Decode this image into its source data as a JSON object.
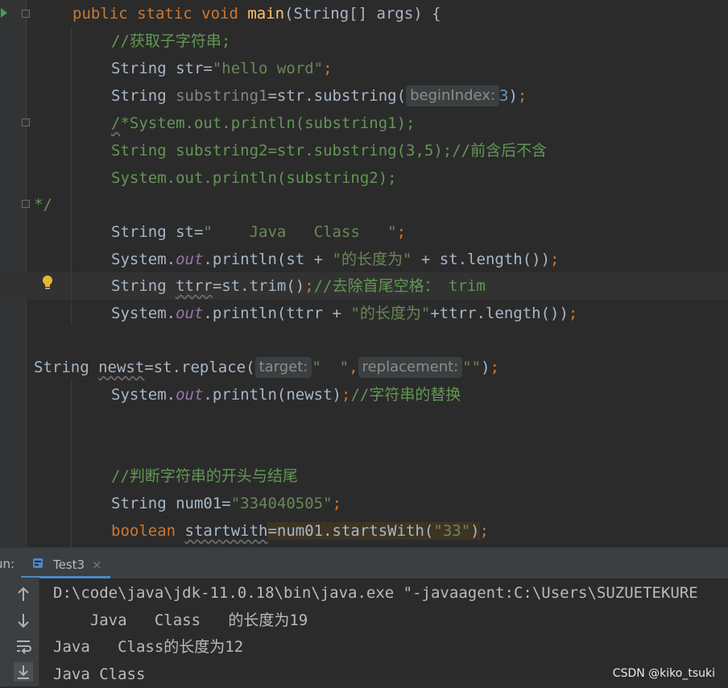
{
  "editor": {
    "lines": {
      "l1": {
        "kw1": "public static void ",
        "fn": "main",
        "rest": "(String[] args) {"
      },
      "l2": {
        "comment": "//获取子字符串;"
      },
      "l3": {
        "t1": "String str=",
        "s1": "\"hello word\"",
        "p1": ";"
      },
      "l4": {
        "t1": "String ",
        "v1": "substring1",
        "t2": "=str.substring(",
        "hint": "beginIndex:",
        "n1": "3",
        "t3": ")",
        "p1": ";"
      },
      "l5": {
        "c1": "/",
        "c2": "*System.out.println(substring1);"
      },
      "l6": {
        "c1": "String substring2=str.substring(3,5);//前含后不含"
      },
      "l7": {
        "c1": "System.out.println(substring2);"
      },
      "l8": {
        "c1": "*/"
      },
      "l9": {
        "t1": "String st=",
        "s1": "\"    Java   Class   \"",
        "p1": ";"
      },
      "l10": {
        "t1": "System.",
        "f1": "out",
        "t2": ".println(st + ",
        "s1": "\"的长度为\"",
        "t3": " + st.length())",
        "p1": ";"
      },
      "l11": {
        "t1": "String ",
        "v1": "ttrr",
        "t2": "=st.trim()",
        "p1": ";",
        "c1": "//去除首尾空格： trim"
      },
      "l12": {
        "t1": "System.",
        "f1": "out",
        "t2": ".println(ttrr + ",
        "s1": "\"的长度为\"",
        "t3": "+ttrr.length())",
        "p1": ";"
      },
      "l13": {
        "t1": "String ",
        "v1": "newst",
        "t2": "=st.replace(",
        "hint1": "target:",
        "s1": "\"  \"",
        "p0": ",",
        "hint2": "replacement:",
        "s2": "\"\"",
        "t3": ")",
        "p1": ";"
      },
      "l14": {
        "t1": "System.",
        "f1": "out",
        "t2": ".println(newst)",
        "p1": ";",
        "c1": "//字符串的替换"
      },
      "l15": {
        "c1": "//判断字符串的开头与结尾"
      },
      "l16": {
        "t1": "String num01=",
        "s1": "\"334040505\"",
        "p1": ";"
      },
      "l17": {
        "kw1": "boolean ",
        "v1": "startwith",
        "t2": "=num01.startsWith(",
        "s1": "\"33\"",
        "t3": ")",
        "p1": ";"
      }
    }
  },
  "run_panel": {
    "title": "un:",
    "tab_label": "Test3",
    "tab_close": "×",
    "output": [
      "D:\\code\\java\\jdk-11.0.18\\bin\\java.exe \"-javaagent:C:\\Users\\SUZUETEKURE",
      "    Java   Class   的长度为19",
      "Java   Class的长度为12",
      "Java Class"
    ]
  },
  "watermark": "CSDN @kiko_tsuki",
  "colors": {
    "background": "#2b2b2b",
    "keyword": "#cc7832",
    "string": "#6a8759",
    "comment": "#629755",
    "number": "#6897bb",
    "function": "#ffc66d",
    "field": "#9876aa"
  },
  "icons": [
    "run-arrow-icon",
    "fold-icon",
    "lightbulb-icon",
    "run-tab-icon",
    "close-icon",
    "arrow-up-icon",
    "arrow-down-icon",
    "soft-wrap-icon",
    "scroll-to-end-icon"
  ]
}
